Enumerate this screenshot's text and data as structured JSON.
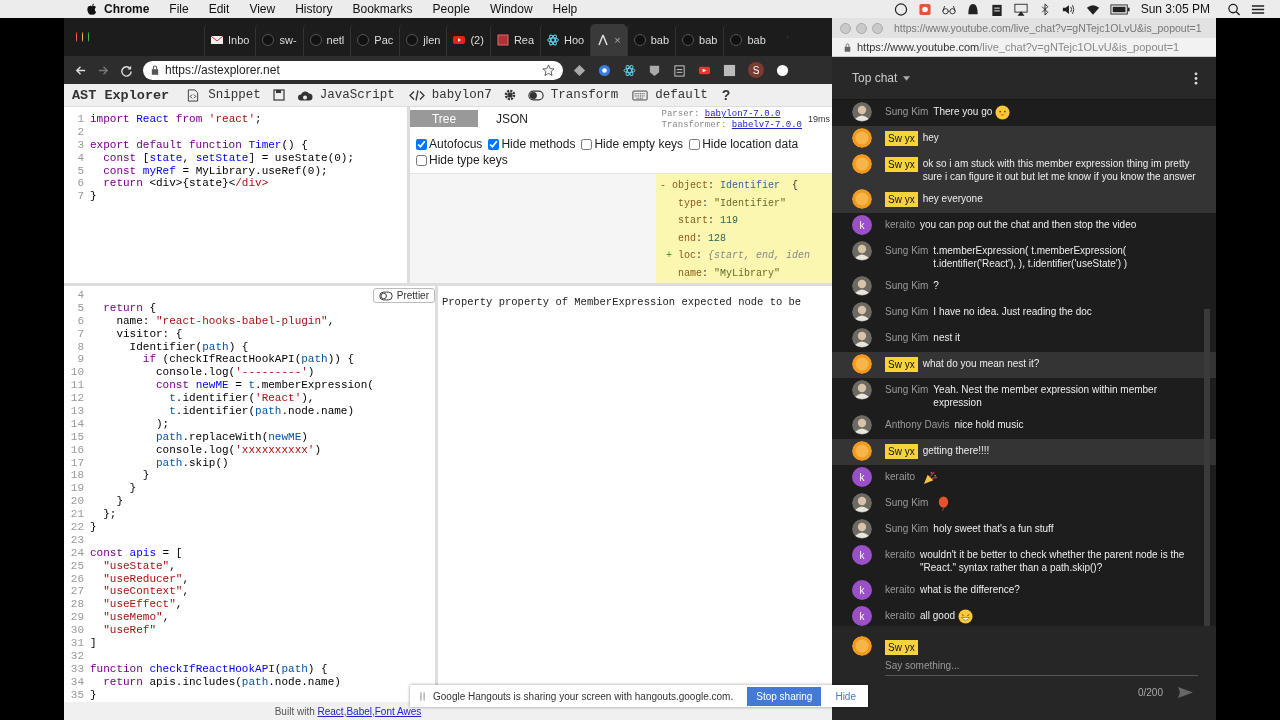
{
  "menubar": {
    "menus": [
      {
        "label": "Chrome"
      },
      {
        "label": "File"
      },
      {
        "label": "Edit"
      },
      {
        "label": "View"
      },
      {
        "label": "History"
      },
      {
        "label": "Bookmarks"
      },
      {
        "label": "People"
      },
      {
        "label": "Window"
      },
      {
        "label": "Help"
      }
    ],
    "clock": "Sun 3:05 PM"
  },
  "browser": {
    "tabs": [
      {
        "label": "Inbo",
        "kind": "mail",
        "selected": false
      },
      {
        "label": "sw-",
        "kind": "github",
        "selected": false
      },
      {
        "label": "netl",
        "kind": "github",
        "selected": false
      },
      {
        "label": "Pac",
        "kind": "github",
        "selected": false
      },
      {
        "label": "jlen",
        "kind": "github",
        "selected": false
      },
      {
        "label": "(2)",
        "kind": "youtube",
        "selected": false
      },
      {
        "label": "Rea",
        "kind": "square",
        "selected": false
      },
      {
        "label": "Hoo",
        "kind": "react",
        "selected": false
      },
      {
        "kind": "ast",
        "selected": true,
        "close": "×"
      },
      {
        "label": "bab",
        "kind": "github",
        "selected": false
      },
      {
        "label": "bab",
        "kind": "github",
        "selected": false
      },
      {
        "label": "bab",
        "kind": "github",
        "selected": false
      }
    ],
    "url": "https://astexplorer.net",
    "profile_letter": "S"
  },
  "toolbar": {
    "title": "AST Explorer",
    "snippet": "Snippet",
    "language": "JavaScript",
    "parser": "babylon7",
    "transform": {
      "label": "Transform",
      "on": false
    },
    "keymap": "default",
    "help": "?"
  },
  "source_editor": {
    "lines": [
      {
        "number": "1",
        "tokens": [
          {
            "kind": "keyword",
            "text": "import "
          },
          {
            "kind": "def",
            "text": "React "
          },
          {
            "kind": "keyword",
            "text": "from "
          },
          {
            "kind": "string",
            "text": "'react'"
          },
          {
            "kind": "plain",
            "text": ";"
          }
        ]
      },
      {
        "number": "2"
      },
      {
        "number": "3",
        "tokens": [
          {
            "kind": "keyword",
            "text": "export default function "
          },
          {
            "kind": "def",
            "text": "Timer"
          },
          {
            "kind": "plain",
            "text": "() {"
          }
        ]
      },
      {
        "number": "4",
        "tokens": [
          {
            "kind": "keyword",
            "text": "  const"
          },
          {
            "kind": "plain",
            "text": " ["
          },
          {
            "kind": "def",
            "text": "state"
          },
          {
            "kind": "plain",
            "text": ", "
          },
          {
            "kind": "def",
            "text": "setState"
          },
          {
            "kind": "plain",
            "text": "] = useState(0);"
          }
        ]
      },
      {
        "number": "5",
        "tokens": [
          {
            "kind": "keyword",
            "text": "  const"
          },
          {
            "kind": "def",
            "text": " myRef"
          },
          {
            "kind": "plain",
            "text": " = MyLibrary.useRef(0);"
          }
        ]
      },
      {
        "number": "6",
        "tokens": [
          {
            "kind": "keyword",
            "text": "  return"
          },
          {
            "kind": "plain",
            "text": " <div>{state}<"
          },
          {
            "kind": "tag",
            "text": "/div>"
          }
        ]
      },
      {
        "number": "7",
        "tokens": [
          {
            "kind": "plain",
            "text": "}"
          }
        ]
      }
    ]
  },
  "ast_panel": {
    "tabs": [
      {
        "label": "Tree",
        "selected": true
      },
      {
        "label": "JSON",
        "selected": false
      }
    ],
    "parser_label": "Parser:",
    "parser_link": "babylon7-7.0.0",
    "transformer_label": "Transformer:",
    "transformer_link": "babelv7-7.0.0",
    "time": "19ms",
    "options": [
      {
        "label": "Autofocus",
        "checked": true
      },
      {
        "label": "Hide methods",
        "checked": true
      },
      {
        "label": "Hide empty keys",
        "checked": false
      },
      {
        "label": "Hide location data",
        "checked": false
      },
      {
        "label": "Hide type keys",
        "checked": false
      }
    ],
    "tree": [
      {
        "tokens": [
          {
            "kind": "minus",
            "text": "- "
          },
          {
            "kind": "key",
            "text": "object"
          },
          {
            "kind": "plain",
            "text": ": "
          },
          {
            "kind": "type",
            "text": "Identifier"
          },
          {
            "kind": "plain",
            "text": "  {"
          }
        ]
      },
      {
        "tokens": [
          {
            "kind": "key",
            "text": "   type"
          },
          {
            "kind": "plain",
            "text": ": "
          },
          {
            "kind": "str",
            "text": "\"Identifier\""
          }
        ]
      },
      {
        "tokens": [
          {
            "kind": "key",
            "text": "   start"
          },
          {
            "kind": "plain",
            "text": ": "
          },
          {
            "kind": "num",
            "text": "119"
          }
        ]
      },
      {
        "tokens": [
          {
            "kind": "key",
            "text": "   end"
          },
          {
            "kind": "plain",
            "text": ": "
          },
          {
            "kind": "num",
            "text": "128"
          }
        ]
      },
      {
        "tokens": [
          {
            "kind": "plus",
            "text": " + "
          },
          {
            "kind": "key",
            "text": "loc"
          },
          {
            "kind": "plain",
            "text": ": "
          },
          {
            "kind": "meta",
            "text": "{start, end, iden"
          }
        ]
      },
      {
        "tokens": [
          {
            "kind": "key",
            "text": "   name"
          },
          {
            "kind": "plain",
            "text": ": "
          },
          {
            "kind": "str",
            "text": "\"MyLibrary\""
          }
        ]
      }
    ]
  },
  "transform_editor": {
    "prettier": {
      "label": "Prettier",
      "on": false
    },
    "lines": [
      {
        "number": "4"
      },
      {
        "number": "5",
        "tokens": [
          {
            "kind": "keyword",
            "text": "  return"
          },
          {
            "kind": "plain",
            "text": " {"
          }
        ]
      },
      {
        "number": "6",
        "tokens": [
          {
            "kind": "plain",
            "text": "    name: "
          },
          {
            "kind": "string",
            "text": "\"react-hooks-babel-plugin\""
          },
          {
            "kind": "plain",
            "text": ","
          }
        ]
      },
      {
        "number": "7",
        "tokens": [
          {
            "kind": "plain",
            "text": "    visitor: {"
          }
        ]
      },
      {
        "number": "8",
        "tokens": [
          {
            "kind": "plain",
            "text": "      Identifier("
          },
          {
            "kind": "var",
            "text": "path"
          },
          {
            "kind": "plain",
            "text": ") {"
          }
        ]
      },
      {
        "number": "9",
        "tokens": [
          {
            "kind": "keyword",
            "text": "        if"
          },
          {
            "kind": "plain",
            "text": " (checkIfReactHookAPI("
          },
          {
            "kind": "var",
            "text": "path"
          },
          {
            "kind": "plain",
            "text": ")) {"
          }
        ]
      },
      {
        "number": "10",
        "tokens": [
          {
            "kind": "plain",
            "text": "          console.log("
          },
          {
            "kind": "string",
            "text": "'---------'"
          },
          {
            "kind": "plain",
            "text": ")"
          }
        ]
      },
      {
        "number": "11",
        "tokens": [
          {
            "kind": "keyword",
            "text": "          const"
          },
          {
            "kind": "def",
            "text": " newME"
          },
          {
            "kind": "plain",
            "text": " = "
          },
          {
            "kind": "var",
            "text": "t"
          },
          {
            "kind": "plain",
            "text": ".memberExpression("
          }
        ]
      },
      {
        "number": "12",
        "tokens": [
          {
            "kind": "var",
            "text": "            t"
          },
          {
            "kind": "plain",
            "text": ".identifier("
          },
          {
            "kind": "string",
            "text": "'React'"
          },
          {
            "kind": "plain",
            "text": "),"
          }
        ]
      },
      {
        "number": "13",
        "tokens": [
          {
            "kind": "var",
            "text": "            t"
          },
          {
            "kind": "plain",
            "text": ".identifier("
          },
          {
            "kind": "var",
            "text": "path"
          },
          {
            "kind": "plain",
            "text": ".node.name)"
          }
        ]
      },
      {
        "number": "14",
        "tokens": [
          {
            "kind": "plain",
            "text": "          );"
          }
        ]
      },
      {
        "number": "15",
        "tokens": [
          {
            "kind": "var",
            "text": "          path"
          },
          {
            "kind": "plain",
            "text": ".replaceWith("
          },
          {
            "kind": "var",
            "text": "newME"
          },
          {
            "kind": "plain",
            "text": ")"
          }
        ]
      },
      {
        "number": "16",
        "tokens": [
          {
            "kind": "plain",
            "text": "          console.log("
          },
          {
            "kind": "string",
            "text": "'xxxxxxxxxx'"
          },
          {
            "kind": "plain",
            "text": ")"
          }
        ]
      },
      {
        "number": "17",
        "tokens": [
          {
            "kind": "var",
            "text": "          path"
          },
          {
            "kind": "plain",
            "text": ".skip()"
          }
        ]
      },
      {
        "number": "18",
        "tokens": [
          {
            "kind": "plain",
            "text": "        }"
          }
        ]
      },
      {
        "number": "19",
        "tokens": [
          {
            "kind": "plain",
            "text": "      }"
          }
        ]
      },
      {
        "number": "20",
        "tokens": [
          {
            "kind": "plain",
            "text": "    }"
          }
        ]
      },
      {
        "number": "21",
        "tokens": [
          {
            "kind": "plain",
            "text": "  };"
          }
        ]
      },
      {
        "number": "22",
        "tokens": [
          {
            "kind": "plain",
            "text": "}"
          }
        ]
      },
      {
        "number": "23"
      },
      {
        "number": "24",
        "tokens": [
          {
            "kind": "keyword",
            "text": "const "
          },
          {
            "kind": "def",
            "text": "apis"
          },
          {
            "kind": "plain",
            "text": " = ["
          }
        ]
      },
      {
        "number": "25",
        "tokens": [
          {
            "kind": "string",
            "text": "  \"useState\""
          },
          {
            "kind": "plain",
            "text": ","
          }
        ]
      },
      {
        "number": "26",
        "tokens": [
          {
            "kind": "string",
            "text": "  \"useReducer\""
          },
          {
            "kind": "plain",
            "text": ","
          }
        ]
      },
      {
        "number": "27",
        "tokens": [
          {
            "kind": "string",
            "text": "  \"useContext\""
          },
          {
            "kind": "plain",
            "text": ","
          }
        ]
      },
      {
        "number": "28",
        "tokens": [
          {
            "kind": "string",
            "text": "  \"useEffect\""
          },
          {
            "kind": "plain",
            "text": ","
          }
        ]
      },
      {
        "number": "29",
        "tokens": [
          {
            "kind": "string",
            "text": "  \"useMemo\""
          },
          {
            "kind": "plain",
            "text": ","
          }
        ]
      },
      {
        "number": "30",
        "tokens": [
          {
            "kind": "string",
            "text": "  \"useRef\""
          }
        ]
      },
      {
        "number": "31",
        "tokens": [
          {
            "kind": "plain",
            "text": "]"
          }
        ]
      },
      {
        "number": "32"
      },
      {
        "number": "33",
        "tokens": [
          {
            "kind": "keyword",
            "text": "function "
          },
          {
            "kind": "def",
            "text": "checkIfReactHookAPI"
          },
          {
            "kind": "plain",
            "text": "("
          },
          {
            "kind": "var",
            "text": "path"
          },
          {
            "kind": "plain",
            "text": ") {"
          }
        ]
      },
      {
        "number": "34",
        "tokens": [
          {
            "kind": "keyword",
            "text": "  return"
          },
          {
            "kind": "plain",
            "text": " apis.includes("
          },
          {
            "kind": "var",
            "text": "path"
          },
          {
            "kind": "plain",
            "text": ".node.name)"
          }
        ]
      },
      {
        "number": "35",
        "tokens": [
          {
            "kind": "plain",
            "text": "}"
          }
        ]
      }
    ]
  },
  "output": {
    "error": "Property property of MemberExpression expected node to be"
  },
  "footer": {
    "prefix": "Built with",
    "links": [
      "React",
      "Babel",
      "Font Awes"
    ],
    "separator": ","
  },
  "chat_window": {
    "title_url": "https://www.youtube.com/live_chat?v=gNTejc1OLvU&is_popout=1",
    "url_host": "https://www.youtube.com",
    "url_path": "/live_chat?v=gNTejc1OLvU&is_popout=1",
    "header": "Top chat",
    "messages": [
      {
        "author": "Sung Kim",
        "avatar": {
          "kind": "photo"
        },
        "owner": false,
        "highlighted": false,
        "text": "There you go",
        "emoji": {
          "kind": "smile"
        }
      },
      {
        "author": "Sw yx",
        "avatar": {
          "kind": "orange"
        },
        "owner": true,
        "highlighted": true,
        "text": "hey"
      },
      {
        "author": "Sw yx",
        "avatar": {
          "kind": "orange"
        },
        "owner": true,
        "highlighted": true,
        "text": "ok so i am stuck with this member expression thing im pretty sure i can figure it out but let me know if you know the answer"
      },
      {
        "author": "Sw yx",
        "avatar": {
          "kind": "orange"
        },
        "owner": true,
        "highlighted": true,
        "text": "hey everyone"
      },
      {
        "author": "keraito",
        "avatar": {
          "kind": "letter",
          "letter": "k"
        },
        "owner": false,
        "highlighted": false,
        "text": "you can pop out the chat and then stop the video"
      },
      {
        "author": "Sung Kim",
        "avatar": {
          "kind": "photo"
        },
        "owner": false,
        "highlighted": false,
        "text": "t.memberExpression( t.memberExpression( t.identifier('React'), ), t.identifier('useState') )"
      },
      {
        "author": "Sung Kim",
        "avatar": {
          "kind": "photo"
        },
        "owner": false,
        "highlighted": false,
        "text": "?"
      },
      {
        "author": "Sung Kim",
        "avatar": {
          "kind": "photo"
        },
        "owner": false,
        "highlighted": false,
        "text": "I have no idea. Just reading the doc"
      },
      {
        "author": "Sung Kim",
        "avatar": {
          "kind": "photo"
        },
        "owner": false,
        "highlighted": false,
        "text": "nest it"
      },
      {
        "author": "Sw yx",
        "avatar": {
          "kind": "orange"
        },
        "owner": true,
        "highlighted": true,
        "text": "what do you mean nest it?"
      },
      {
        "author": "Sung Kim",
        "avatar": {
          "kind": "photo"
        },
        "owner": false,
        "highlighted": false,
        "text": "Yeah. Nest the member expression within member expression"
      },
      {
        "author": "Anthony Davis",
        "avatar": {
          "kind": "photo"
        },
        "owner": false,
        "highlighted": false,
        "text": "nice hold music"
      },
      {
        "author": "Sw yx",
        "avatar": {
          "kind": "orange"
        },
        "owner": true,
        "highlighted": true,
        "text": "getting there!!!!"
      },
      {
        "author": "keraito",
        "avatar": {
          "kind": "letter",
          "letter": "k"
        },
        "owner": false,
        "highlighted": false,
        "emoji": {
          "kind": "party"
        }
      },
      {
        "author": "Sung Kim",
        "avatar": {
          "kind": "photo"
        },
        "owner": false,
        "highlighted": false,
        "emoji": {
          "kind": "balloon"
        }
      },
      {
        "author": "Sung Kim",
        "avatar": {
          "kind": "photo"
        },
        "owner": false,
        "highlighted": false,
        "text": "holy sweet that's a fun stuff"
      },
      {
        "author": "keraito",
        "avatar": {
          "kind": "letter",
          "letter": "k"
        },
        "owner": false,
        "highlighted": false,
        "text": "wouldn't it be better to check whether the parent node is the \"React.\" syntax rather than a path.skip()?"
      },
      {
        "author": "keraito",
        "avatar": {
          "kind": "letter",
          "letter": "k"
        },
        "owner": false,
        "highlighted": false,
        "text": "what is the difference?"
      },
      {
        "author": "keraito",
        "avatar": {
          "kind": "letter",
          "letter": "k"
        },
        "owner": false,
        "highlighted": false,
        "text": "all good",
        "emoji": {
          "kind": "laugh"
        }
      }
    ],
    "composer": {
      "author": "Sw yx",
      "owner": true,
      "avatar": {
        "kind": "orange"
      },
      "placeholder": "Say something...",
      "counter": "0/200"
    }
  },
  "share_bar": {
    "message": "Google Hangouts is sharing your screen with hangouts.google.com.",
    "stop": "Stop sharing",
    "hide": "Hide"
  }
}
